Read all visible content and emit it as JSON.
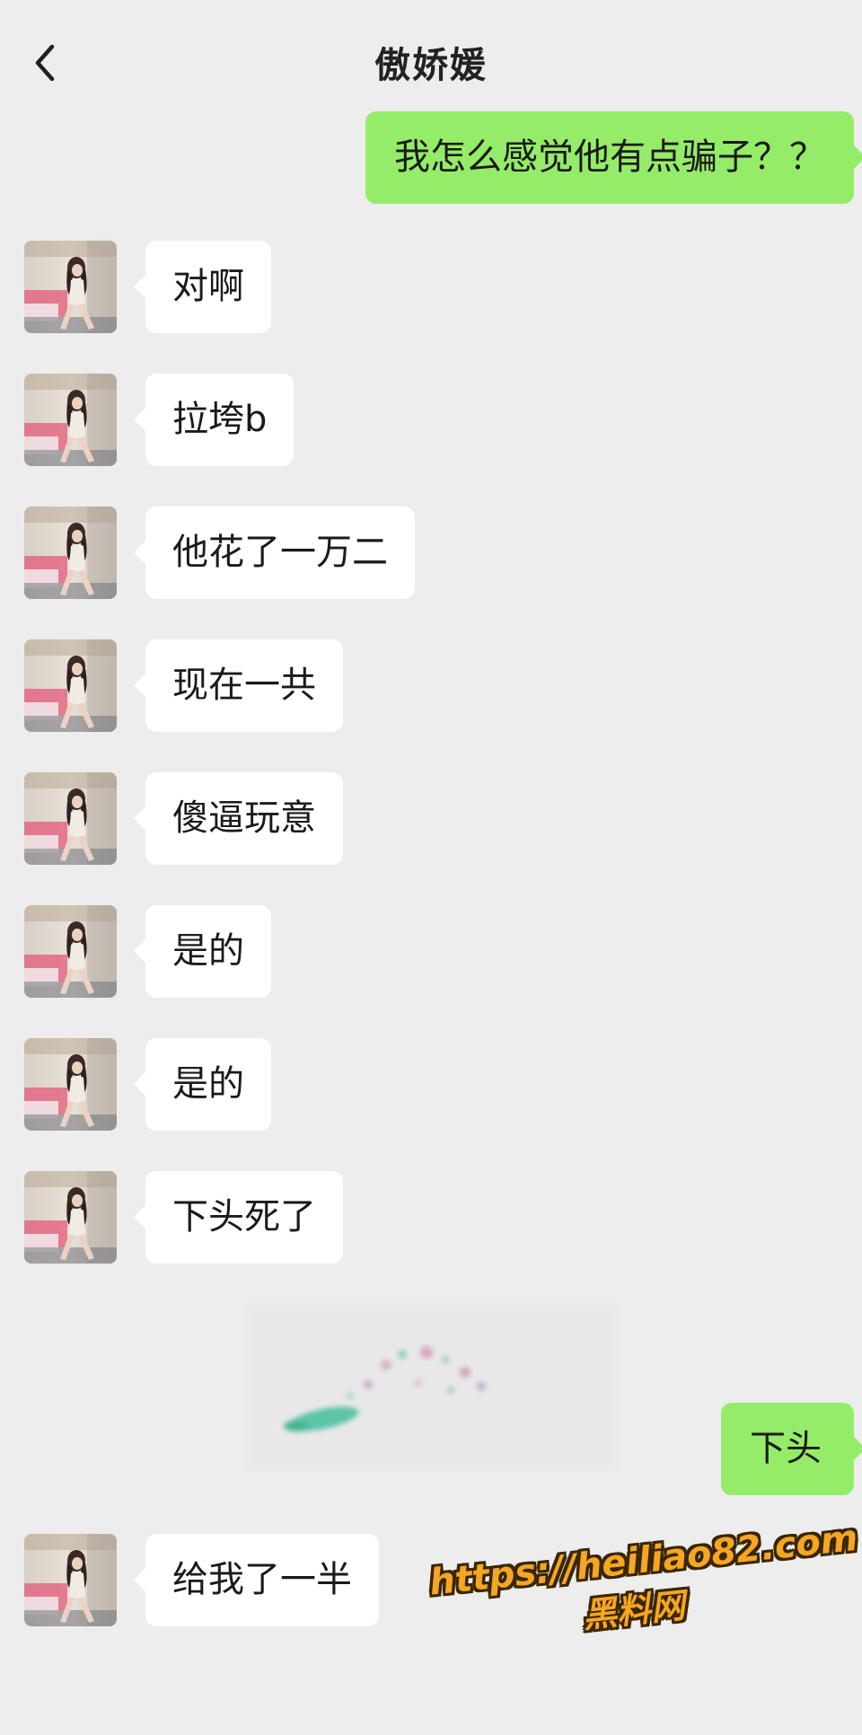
{
  "header": {
    "back_icon": "chevron-left-icon",
    "title": "傲娇媛"
  },
  "messages": [
    {
      "side": "out",
      "text": "我怎么感觉他有点骗子？？"
    },
    {
      "side": "in",
      "text": "对啊"
    },
    {
      "side": "in",
      "text": "拉垮b"
    },
    {
      "side": "in",
      "text": "他花了一万二"
    },
    {
      "side": "in",
      "text": "现在一共"
    },
    {
      "side": "in",
      "text": "傻逼玩意"
    },
    {
      "side": "in",
      "text": "是的"
    },
    {
      "side": "in",
      "text": "是的"
    },
    {
      "side": "in",
      "text": "下头死了"
    },
    {
      "side": "sticker",
      "text": ""
    },
    {
      "side": "out",
      "text": "下头"
    },
    {
      "side": "in",
      "text": "给我了一半"
    }
  ],
  "watermark": {
    "url": "https://heiliao82.com",
    "site": "黑料网"
  },
  "colors": {
    "background": "#ededed",
    "incoming_bubble": "#ffffff",
    "outgoing_bubble": "#95ec69",
    "watermark": "#f5a623"
  }
}
